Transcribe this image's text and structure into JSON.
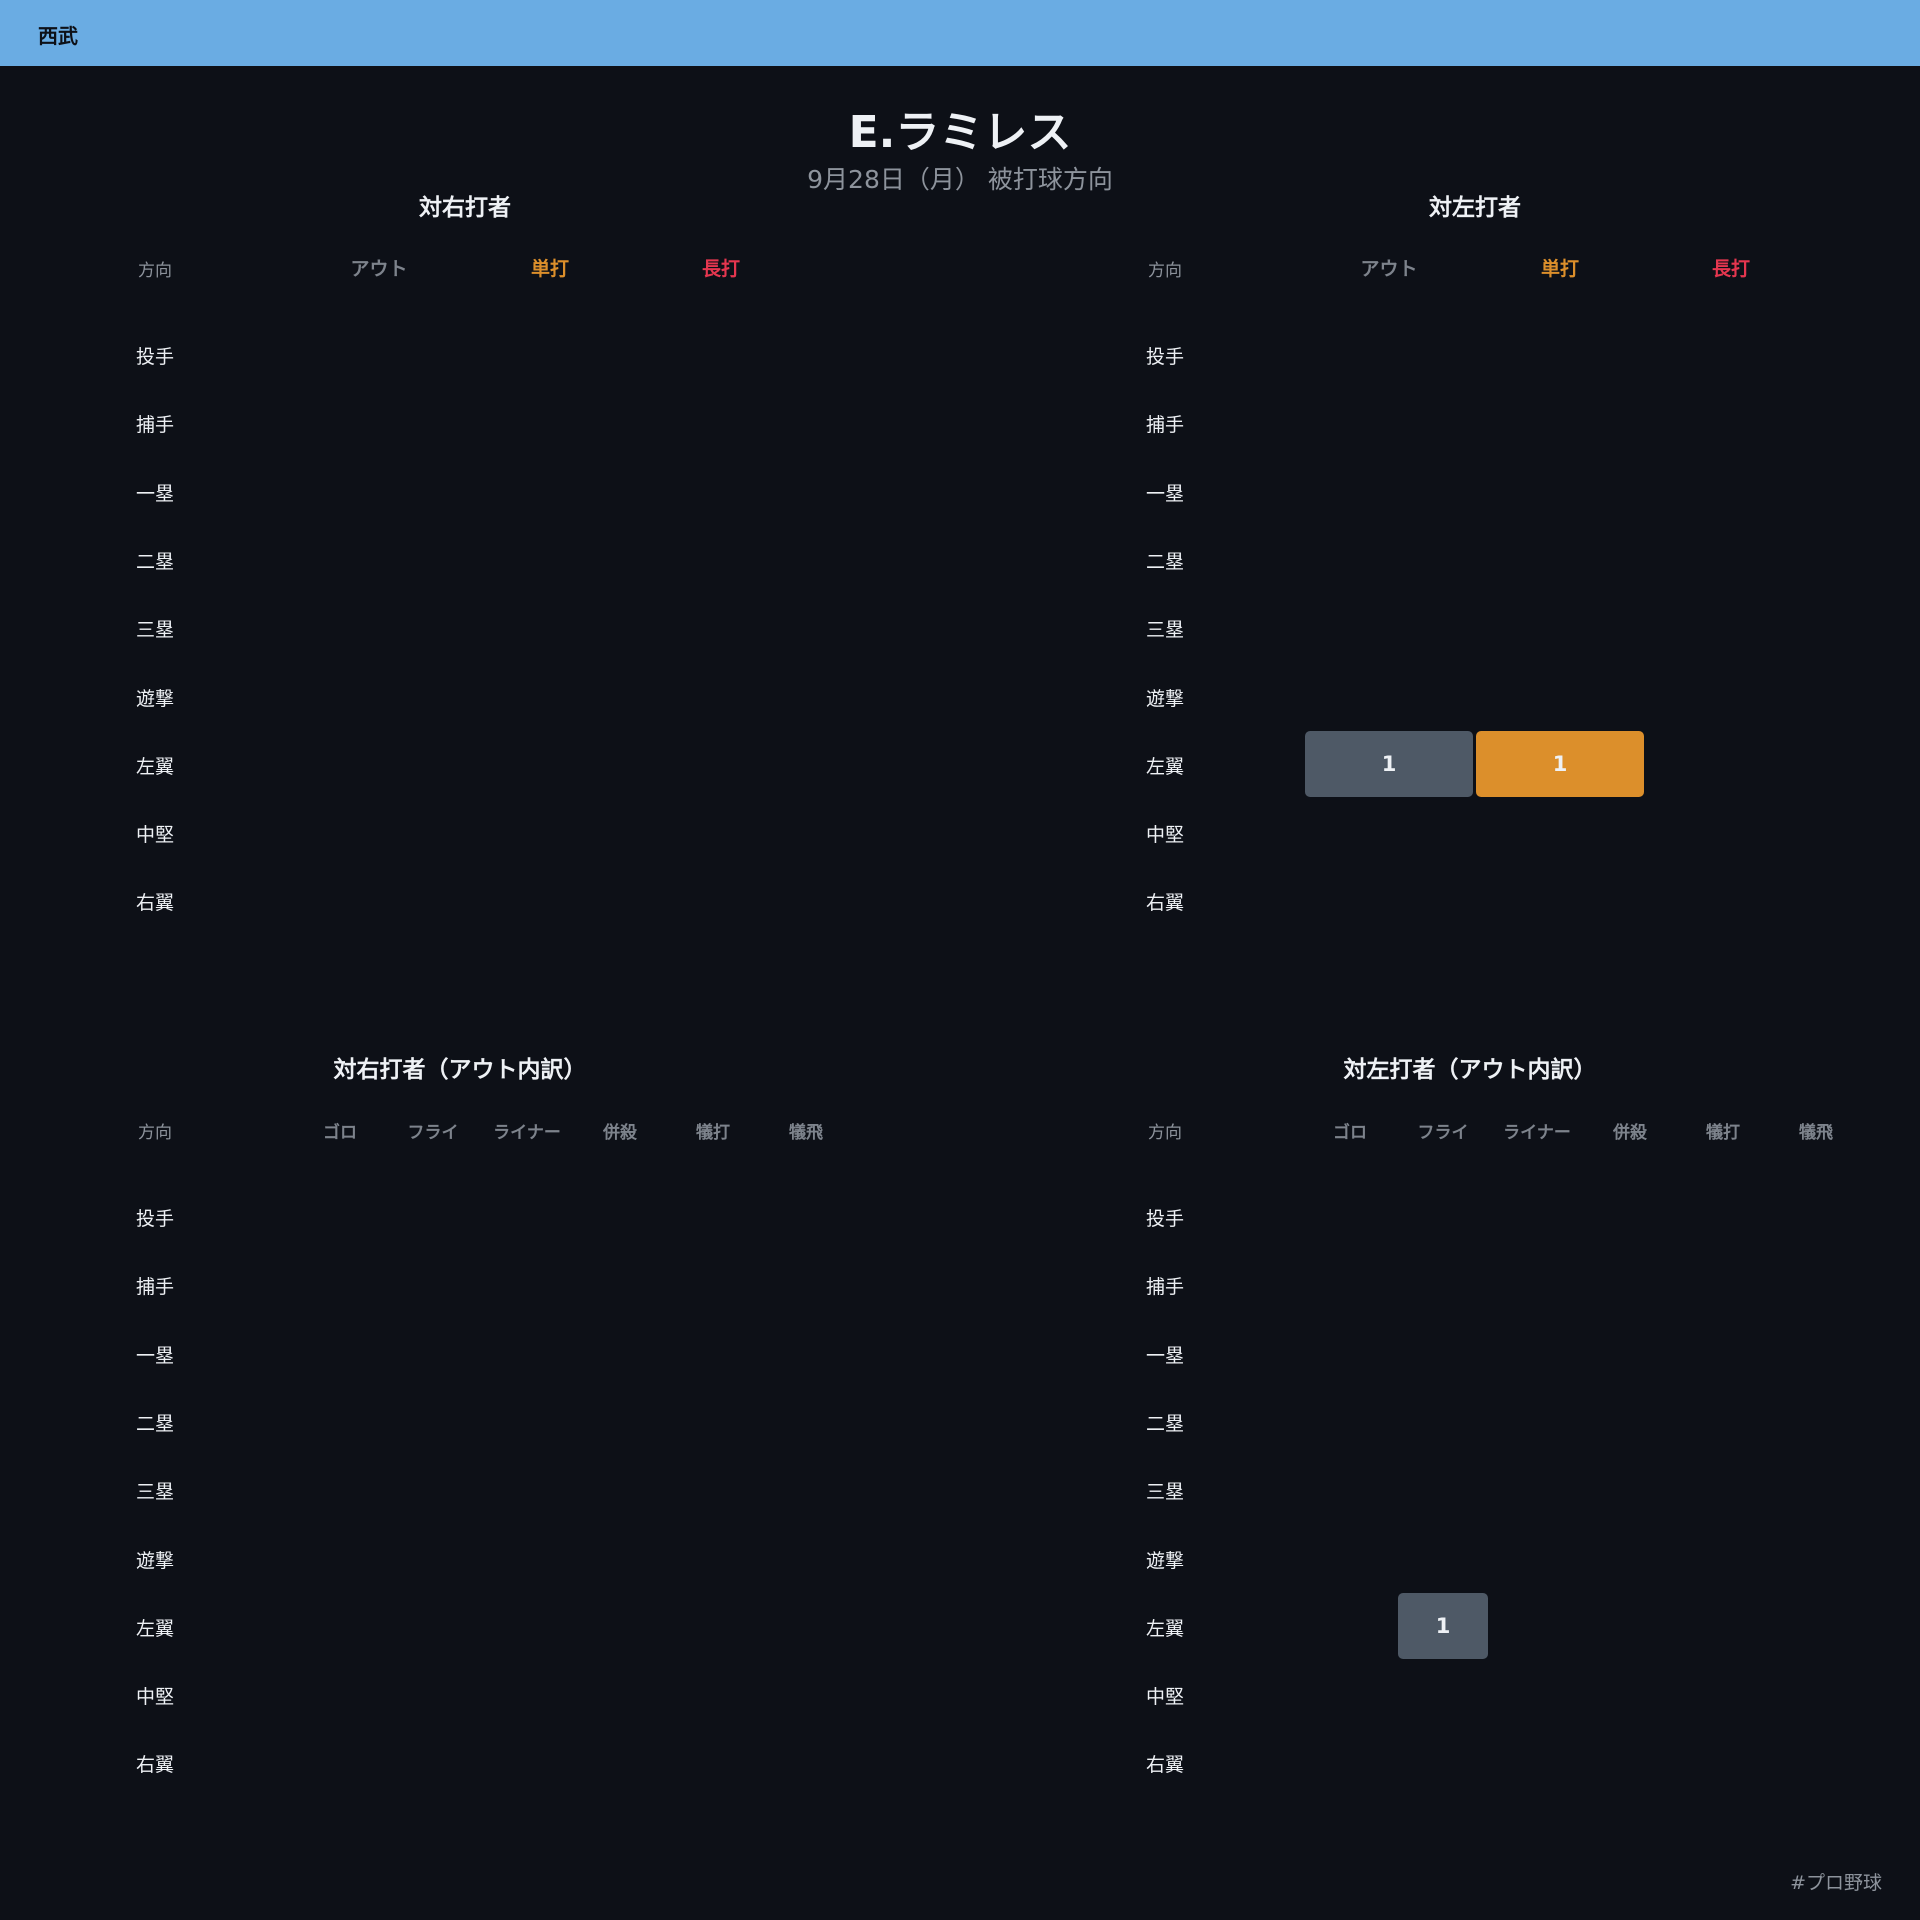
{
  "header": {
    "team": "西武"
  },
  "title": {
    "player": "E.ラミレス",
    "subtitle": "9月28日（月） 被打球方向"
  },
  "directions": [
    "投手",
    "捕手",
    "一塁",
    "二塁",
    "三塁",
    "遊撃",
    "左翼",
    "中堅",
    "右翼"
  ],
  "dir_label": "方向",
  "footer": {
    "hashtag": "#プロ野球"
  },
  "colors": {
    "out": "#4e5966",
    "single": "#dc8f2b",
    "extra": "#e5364f",
    "header_gray": "#7d838c"
  },
  "chart_data": [
    {
      "type": "table",
      "title": "対右打者",
      "columns": [
        "アウト",
        "単打",
        "長打"
      ],
      "rows": [
        "投手",
        "捕手",
        "一塁",
        "二塁",
        "三塁",
        "遊撃",
        "左翼",
        "中堅",
        "右翼"
      ],
      "values": [
        [
          0,
          0,
          0
        ],
        [
          0,
          0,
          0
        ],
        [
          0,
          0,
          0
        ],
        [
          0,
          0,
          0
        ],
        [
          0,
          0,
          0
        ],
        [
          0,
          0,
          0
        ],
        [
          0,
          0,
          0
        ],
        [
          0,
          0,
          0
        ],
        [
          0,
          0,
          0
        ]
      ]
    },
    {
      "type": "table",
      "title": "対左打者",
      "columns": [
        "アウト",
        "単打",
        "長打"
      ],
      "rows": [
        "投手",
        "捕手",
        "一塁",
        "二塁",
        "三塁",
        "遊撃",
        "左翼",
        "中堅",
        "右翼"
      ],
      "values": [
        [
          0,
          0,
          0
        ],
        [
          0,
          0,
          0
        ],
        [
          0,
          0,
          0
        ],
        [
          0,
          0,
          0
        ],
        [
          0,
          0,
          0
        ],
        [
          0,
          0,
          0
        ],
        [
          1,
          1,
          0
        ],
        [
          0,
          0,
          0
        ],
        [
          0,
          0,
          0
        ]
      ]
    },
    {
      "type": "table",
      "title": "対右打者（アウト内訳）",
      "columns": [
        "ゴロ",
        "フライ",
        "ライナー",
        "併殺",
        "犠打",
        "犠飛"
      ],
      "rows": [
        "投手",
        "捕手",
        "一塁",
        "二塁",
        "三塁",
        "遊撃",
        "左翼",
        "中堅",
        "右翼"
      ],
      "values": [
        [
          0,
          0,
          0,
          0,
          0,
          0
        ],
        [
          0,
          0,
          0,
          0,
          0,
          0
        ],
        [
          0,
          0,
          0,
          0,
          0,
          0
        ],
        [
          0,
          0,
          0,
          0,
          0,
          0
        ],
        [
          0,
          0,
          0,
          0,
          0,
          0
        ],
        [
          0,
          0,
          0,
          0,
          0,
          0
        ],
        [
          0,
          0,
          0,
          0,
          0,
          0
        ],
        [
          0,
          0,
          0,
          0,
          0,
          0
        ],
        [
          0,
          0,
          0,
          0,
          0,
          0
        ]
      ]
    },
    {
      "type": "table",
      "title": "対左打者（アウト内訳）",
      "columns": [
        "ゴロ",
        "フライ",
        "ライナー",
        "併殺",
        "犠打",
        "犠飛"
      ],
      "rows": [
        "投手",
        "捕手",
        "一塁",
        "二塁",
        "三塁",
        "遊撃",
        "左翼",
        "中堅",
        "右翼"
      ],
      "values": [
        [
          0,
          0,
          0,
          0,
          0,
          0
        ],
        [
          0,
          0,
          0,
          0,
          0,
          0
        ],
        [
          0,
          0,
          0,
          0,
          0,
          0
        ],
        [
          0,
          0,
          0,
          0,
          0,
          0
        ],
        [
          0,
          0,
          0,
          0,
          0,
          0
        ],
        [
          0,
          0,
          0,
          0,
          0,
          0
        ],
        [
          0,
          1,
          0,
          0,
          0,
          0
        ],
        [
          0,
          0,
          0,
          0,
          0,
          0
        ],
        [
          0,
          0,
          0,
          0,
          0,
          0
        ]
      ]
    }
  ]
}
